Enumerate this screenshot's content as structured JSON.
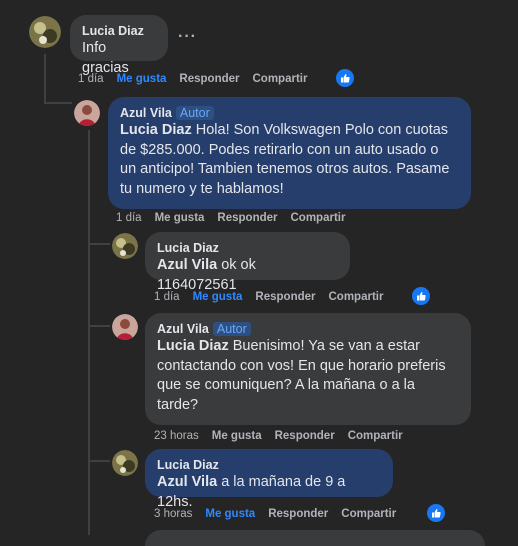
{
  "comments": [
    {
      "author": "Lucia Diaz",
      "text": "Info gracias",
      "time": "1 día",
      "like": "Me gusta",
      "reply": "Responder",
      "share": "Compartir"
    },
    {
      "author": "Azul Vila",
      "badge": "Autor",
      "mention": "Lucia Diaz",
      "text_lines": [
        "Hola! Son Volkswagen Polo con cuotas",
        "de $285.000. Podes retirarlo con un auto usado o",
        "un anticipo! Tambien tenemos otros autos. Pasame",
        "tu numero y te hablamos!"
      ],
      "time": "1 día",
      "like": "Me gusta",
      "reply": "Responder",
      "share": "Compartir"
    },
    {
      "author": "Lucia Diaz",
      "mention": "Azul Vila",
      "text": "ok ok 1164072561",
      "time": "1 día",
      "like": "Me gusta",
      "reply": "Responder",
      "share": "Compartir"
    },
    {
      "author": "Azul Vila",
      "badge": "Autor",
      "mention": "Lucia Diaz",
      "text_lines": [
        "Buenisimo! Ya se van a estar",
        "contactando con vos! En que horario preferis",
        "que se comuniquen? A la mañana o a la",
        "tarde?"
      ],
      "time": "23 horas",
      "like": "Me gusta",
      "reply": "Responder",
      "share": "Compartir"
    },
    {
      "author": "Lucia Diaz",
      "mention": "Azul Vila",
      "text": "a la mañana de 9 a 12hs.",
      "time": "3 horas",
      "like": "Me gusta",
      "reply": "Responder",
      "share": "Compartir"
    }
  ],
  "colors": {
    "background": "#252526",
    "bubble_gray": "#3a3b3c",
    "bubble_blue": "#263e6b",
    "liked": "#2e89ff",
    "like_badge": "#1877f2"
  },
  "icons": [
    "more-options-icon",
    "like-reaction-icon",
    "avatar-lucia",
    "avatar-azul"
  ]
}
